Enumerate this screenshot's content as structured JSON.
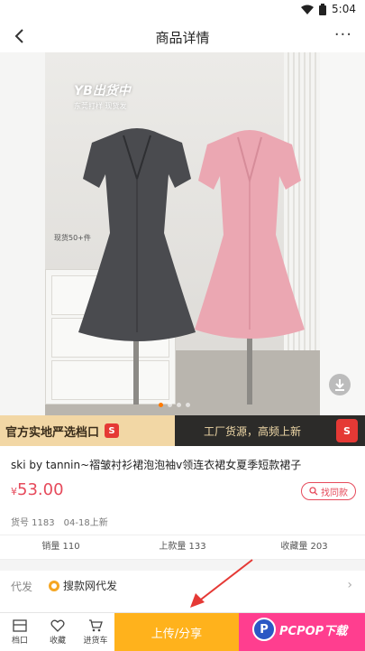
{
  "status_bar": {
    "time": "5:04"
  },
  "nav": {
    "title": "商品详情",
    "more": "···"
  },
  "hero": {
    "overlay_title": "YB出货中",
    "overlay_sub": "东莞打样 现货发",
    "side_note": "现货50+件",
    "page_count": 4,
    "active_page": 1
  },
  "promo": {
    "left_text": "官方实地严选档口",
    "badge": "S",
    "right_text": "工厂货源，高频上新",
    "logo": "S"
  },
  "product": {
    "title": "ski by tannin~褶皱衬衫裙泡泡袖v领连衣裙女夏季短款裙子",
    "price_currency": "¥",
    "price": "53.00",
    "find_same": "找同款",
    "sku_label": "货号 1183",
    "date": "04-18上新"
  },
  "stats": {
    "sales": "销量 110",
    "listings": "上款量 133",
    "favorites": "收藏量 203"
  },
  "agent": {
    "label": "代发",
    "value": "搜款网代发",
    "chevron": "›"
  },
  "bottom": {
    "tab_stall": "档口",
    "tab_favorite": "收藏",
    "tab_cart": "进货车",
    "upload": "上传/分享",
    "watermark": "PCPOP下载",
    "watermark_logo": "P"
  },
  "colors": {
    "price": "#e64a5b",
    "upload": "#ffb21c",
    "pink": "#ff3e8f",
    "promo": "#f2d7a5"
  }
}
